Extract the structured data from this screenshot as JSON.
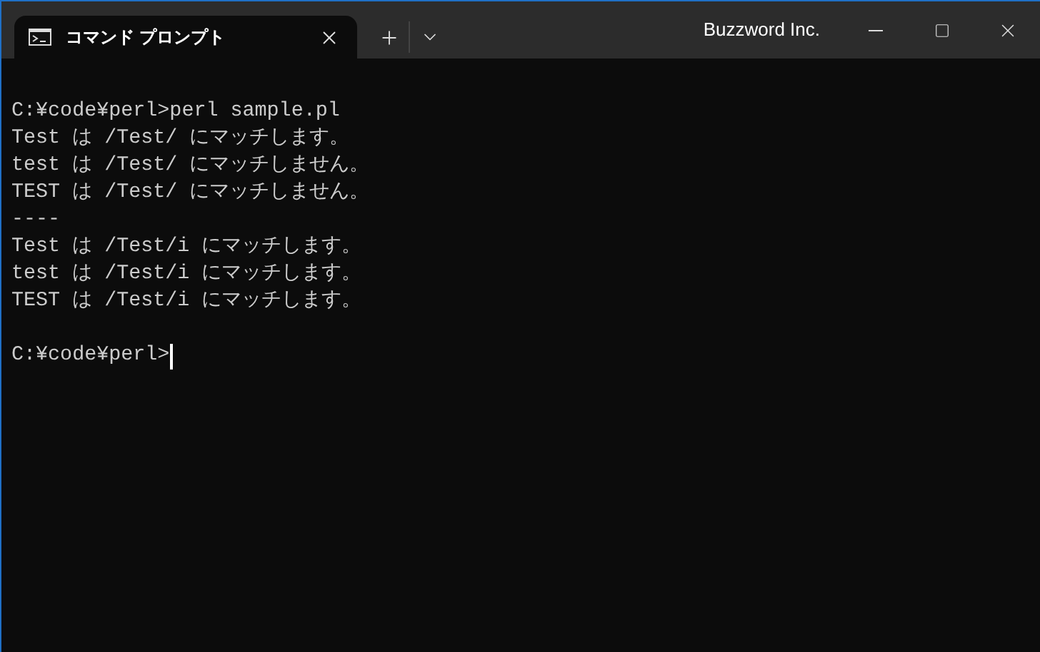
{
  "window": {
    "title": "Buzzword Inc."
  },
  "tabs": [
    {
      "label": "コマンド プロンプト",
      "selected": true
    }
  ],
  "terminal": {
    "lines": [
      "C:¥code¥perl>perl sample.pl",
      "Test は /Test/ にマッチします。",
      "test は /Test/ にマッチしません。",
      "TEST は /Test/ にマッチしません。",
      "----",
      "Test は /Test/i にマッチします。",
      "test は /Test/i にマッチします。",
      "TEST は /Test/i にマッチします。"
    ],
    "prompt": {
      "text": "C:¥code¥perl>",
      "cursor": true
    }
  }
}
